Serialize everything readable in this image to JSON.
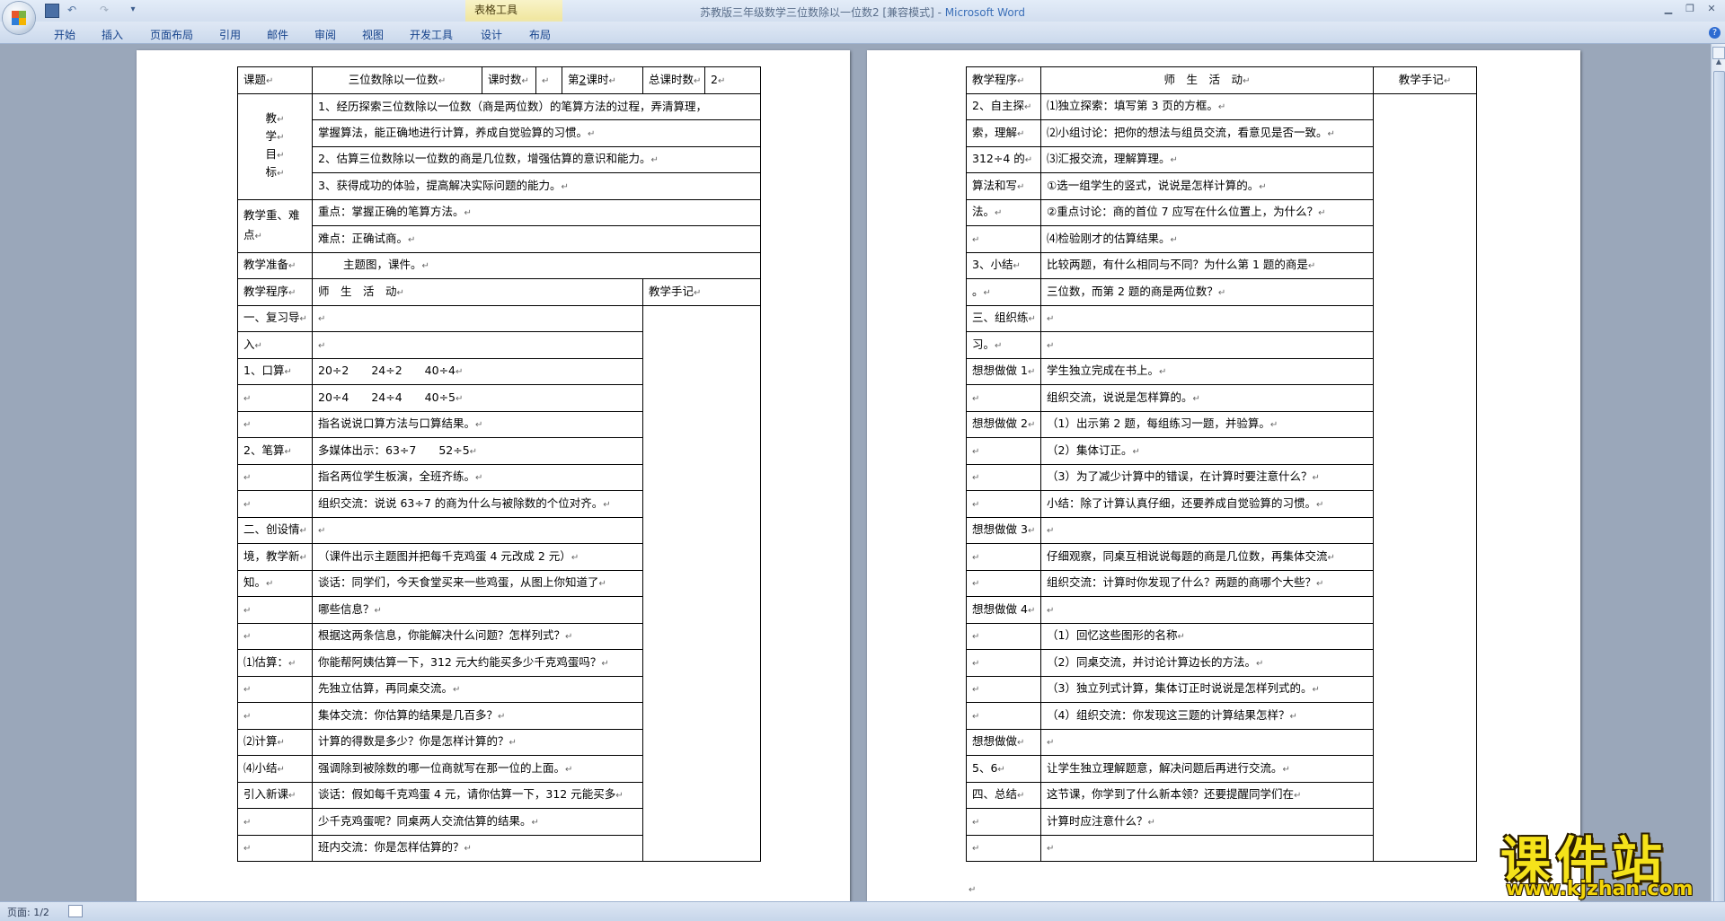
{
  "window": {
    "title_doc": "苏教版三年级数学三位数除以一位数2 [兼容模式] - ",
    "title_app": "Microsoft Word",
    "context_group": "表格工具"
  },
  "ribbon_tabs": [
    "开始",
    "插入",
    "页面布局",
    "引用",
    "邮件",
    "审阅",
    "视图",
    "开发工具",
    "设计",
    "布局"
  ],
  "status": {
    "pages": "页面: 1/2"
  },
  "watermark": {
    "title": "课件站",
    "url": "www.kjzhan.com"
  },
  "page1": {
    "header": {
      "c1": "课题",
      "c2": "三位数除以一位数",
      "c3": "课时数",
      "c4": "",
      "c5_pre": "第",
      "c5_num": "2",
      "c5_post": "课时",
      "c6": "总课时数",
      "c7": "2"
    },
    "goals_label": [
      "教",
      "学",
      "目",
      "标"
    ],
    "goals": [
      "1、经历探索三位数除以一位数（商是两位数）的笔算方法的过程，弄清算理，",
      "掌握算法，能正确地进行计算，养成自觉验算的习惯。",
      "2、估算三位数除以一位数的商是几位数，增强估算的意识和能力。",
      "3、获得成功的体验，提高解决实际问题的能力。"
    ],
    "focus_label": "教学重、难点",
    "focus": [
      "重点：掌握正确的笔算方法。",
      "难点：正确试商。"
    ],
    "prep_label": "教学准备",
    "prep": "主题图，课件。",
    "col_headers": [
      "教学程序",
      "师　生　活　动",
      "教学手记"
    ],
    "rows": [
      {
        "a": "一、复习导",
        "b": ""
      },
      {
        "a": "入",
        "b": ""
      },
      {
        "a": "1、口算",
        "b": "20÷2　　24÷2　　40÷4"
      },
      {
        "a": "",
        "b": "20÷4　　24÷4　　40÷5"
      },
      {
        "a": "",
        "b": "指名说说口算方法与口算结果。"
      },
      {
        "a": "2、笔算",
        "b": "多媒体出示：63÷7　　52÷5"
      },
      {
        "a": "",
        "b": "指名两位学生板演，全班齐练。"
      },
      {
        "a": "",
        "b": "组织交流：说说 63÷7 的商为什么与被除数的个位对齐。"
      },
      {
        "a": "二、创设情",
        "b": ""
      },
      {
        "a": "境，教学新",
        "b": "（课件出示主题图并把每千克鸡蛋 4 元改成 2 元）"
      },
      {
        "a": "知。",
        "b": "谈话：同学们，今天食堂买来一些鸡蛋，从图上你知道了"
      },
      {
        "a": "",
        "b": "哪些信息？"
      },
      {
        "a": "",
        "b": "根据这两条信息，你能解决什么问题？怎样列式？"
      },
      {
        "a": "⑴估算：",
        "b": "你能帮阿姨估算一下，312 元大约能买多少千克鸡蛋吗？"
      },
      {
        "a": "",
        "b": "先独立估算，再同桌交流。"
      },
      {
        "a": "",
        "b": "集体交流：你估算的结果是几百多？"
      },
      {
        "a": "⑵计算",
        "b": "计算的得数是多少？你是怎样计算的？"
      },
      {
        "a": "⑷小结",
        "b": "强调除到被除数的哪一位商就写在那一位的上面。"
      },
      {
        "a": "引入新课",
        "b": "谈话：假如每千克鸡蛋 4 元，请你估算一下，312 元能买多"
      },
      {
        "a": "",
        "b": "少千克鸡蛋呢？同桌两人交流估算的结果。"
      },
      {
        "a": "",
        "b": "班内交流：你是怎样估算的？"
      }
    ]
  },
  "page2": {
    "col_headers": [
      "教学程序",
      "师　生　活　动",
      "教学手记"
    ],
    "rows": [
      {
        "a": "2、自主探",
        "b": "⑴独立探索：填写第 3 页的方框。"
      },
      {
        "a": "索，理解",
        "b": "⑵小组讨论：把你的想法与组员交流，看意见是否一致。"
      },
      {
        "a": "312÷4 的",
        "b": "⑶汇报交流，理解算理。"
      },
      {
        "a": "算法和写",
        "b": "①选一组学生的竖式，说说是怎样计算的。"
      },
      {
        "a": "法。",
        "b": "②重点讨论：商的首位 7 应写在什么位置上，为什么？"
      },
      {
        "a": "",
        "b": "⑷检验刚才的估算结果。"
      },
      {
        "a": "3、小结",
        "b": "比较两题，有什么相同与不同？为什么第 1 题的商是"
      },
      {
        "a": "。",
        "b": "三位数，而第 2 题的商是两位数？"
      },
      {
        "a": "三、组织练",
        "b": ""
      },
      {
        "a": "习。",
        "b": ""
      },
      {
        "a": "想想做做 1",
        "b": "学生独立完成在书上。"
      },
      {
        "a": "",
        "b": "组织交流，说说是怎样算的。"
      },
      {
        "a": "想想做做 2",
        "b": "（1）出示第 2 题，每组练习一题，并验算。"
      },
      {
        "a": "",
        "b": "（2）集体订正。"
      },
      {
        "a": "",
        "b": "（3）为了减少计算中的错误，在计算时要注意什么？"
      },
      {
        "a": "",
        "b": "小结：除了计算认真仔细，还要养成自觉验算的习惯。"
      },
      {
        "a": "想想做做 3",
        "b": ""
      },
      {
        "a": "",
        "b": "仔细观察，同桌互相说说每题的商是几位数，再集体交流"
      },
      {
        "a": "",
        "b": "组织交流：计算时你发现了什么？两题的商哪个大些？"
      },
      {
        "a": "想想做做 4",
        "b": ""
      },
      {
        "a": "",
        "b": "（1）回忆这些图形的名称"
      },
      {
        "a": "",
        "b": "（2）同桌交流，并讨论计算边长的方法。"
      },
      {
        "a": "",
        "b": "（3）独立列式计算，集体订正时说说是怎样列式的。"
      },
      {
        "a": "",
        "b": "（4）组织交流：你发现这三题的计算结果怎样？"
      },
      {
        "a": "想想做做",
        "b": ""
      },
      {
        "a": "5、6",
        "b": "让学生独立理解题意，解决问题后再进行交流。"
      },
      {
        "a": "四、总结",
        "b": "这节课，你学到了什么新本领？还要提醒同学们在"
      },
      {
        "a": "",
        "b": "计算时应注意什么？"
      },
      {
        "a": "",
        "b": ""
      }
    ]
  }
}
